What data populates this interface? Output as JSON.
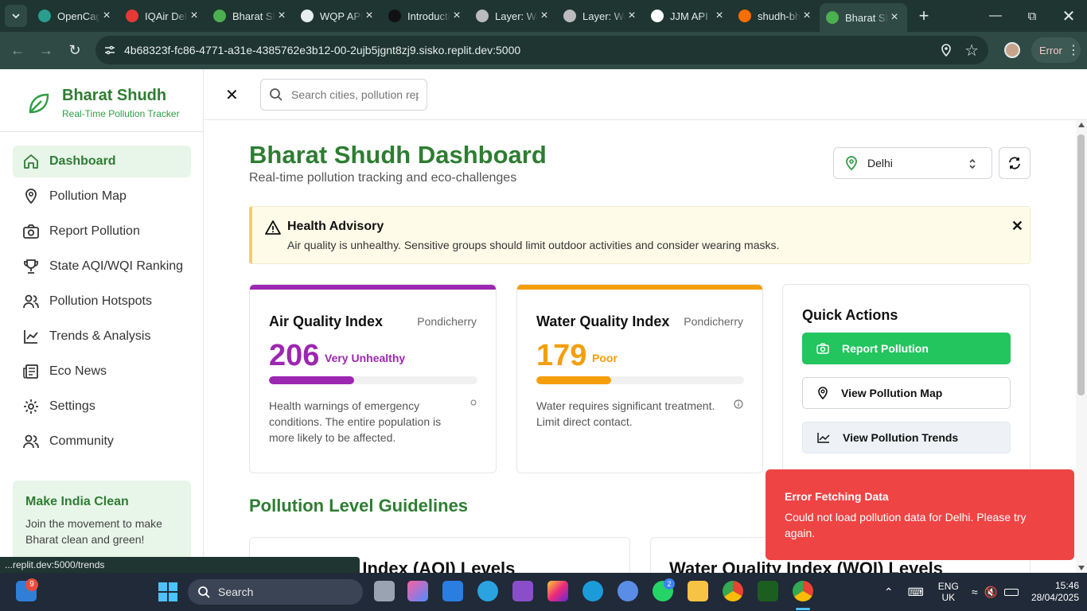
{
  "browser": {
    "tabs": [
      {
        "title": "OpenCage",
        "color": "#2a9d8f"
      },
      {
        "title": "IQAir Delhi",
        "color": "#e53935"
      },
      {
        "title": "Bharat Shudh",
        "color": "#4caf50"
      },
      {
        "title": "WQP API",
        "color": "#e6efec"
      },
      {
        "title": "Introduction",
        "color": "#111111"
      },
      {
        "title": "Layer: Water",
        "color": "#bbbbbb"
      },
      {
        "title": "Layer: Water",
        "color": "#bbbbbb"
      },
      {
        "title": "JJM API",
        "color": "#ffffff"
      },
      {
        "title": "shudh-bharat",
        "color": "#ff6d00"
      },
      {
        "title": "Bharat Shudh",
        "color": "#4caf50"
      }
    ],
    "active_tab": 9,
    "url": "4b68323f-fc86-4771-a31e-4385762e3b12-00-2ujb5jgnt8zj9.sisko.replit.dev:5000",
    "error_label": "Error",
    "status_url": "...replit.dev:5000/trends"
  },
  "sidebar": {
    "brand": "Bharat Shudh",
    "tagline": "Real-Time Pollution Tracker",
    "items": [
      {
        "label": "Dashboard",
        "icon": "home-icon"
      },
      {
        "label": "Pollution Map",
        "icon": "map-pin-icon"
      },
      {
        "label": "Report Pollution",
        "icon": "camera-icon"
      },
      {
        "label": "State AQI/WQI Ranking",
        "icon": "trophy-icon"
      },
      {
        "label": "Pollution Hotspots",
        "icon": "users-icon"
      },
      {
        "label": "Trends & Analysis",
        "icon": "chart-line-icon"
      },
      {
        "label": "Eco News",
        "icon": "newspaper-icon"
      },
      {
        "label": "Settings",
        "icon": "gear-icon"
      },
      {
        "label": "Community",
        "icon": "users-icon"
      }
    ],
    "promo": {
      "title": "Make India Clean",
      "text": "Join the movement to make Bharat clean and green!"
    }
  },
  "header": {
    "search_placeholder": "Search cities, pollution reports..."
  },
  "dashboard": {
    "title": "Bharat Shudh Dashboard",
    "subtitle": "Real-time pollution tracking and eco-challenges",
    "city": "Delhi",
    "advisory": {
      "title": "Health Advisory",
      "text": "Air quality is unhealthy. Sensitive groups should limit outdoor activities and consider wearing masks."
    },
    "aqi": {
      "title": "Air Quality Index",
      "location": "Pondicherry",
      "value": "206",
      "category": "Very Unhealthy",
      "progress": 0.41,
      "color": "#9c27b0",
      "description": "Health warnings of emergency conditions. The entire population is more likely to be affected."
    },
    "wqi": {
      "title": "Water Quality Index",
      "location": "Pondicherry",
      "value": "179",
      "category": "Poor",
      "progress": 0.36,
      "color": "#f59e0b",
      "description": "Water requires significant treatment. Limit direct contact."
    },
    "quick_actions": {
      "title": "Quick Actions",
      "report": "Report Pollution",
      "map": "View Pollution Map",
      "trends": "View Pollution Trends"
    },
    "guidelines": {
      "title": "Pollution Level Guidelines",
      "aqi_card": "Air Quality Index (AQI) Levels",
      "wqi_card": "Water Quality Index (WQI) Levels"
    }
  },
  "toast": {
    "title": "Error Fetching Data",
    "text": "Could not load pollution data for Delhi. Please try again."
  },
  "taskbar": {
    "search": "Search",
    "notif_count": "9",
    "whatsapp_count": "2",
    "lang1": "ENG",
    "lang2": "UK",
    "time": "15:46",
    "date": "28/04/2025"
  }
}
